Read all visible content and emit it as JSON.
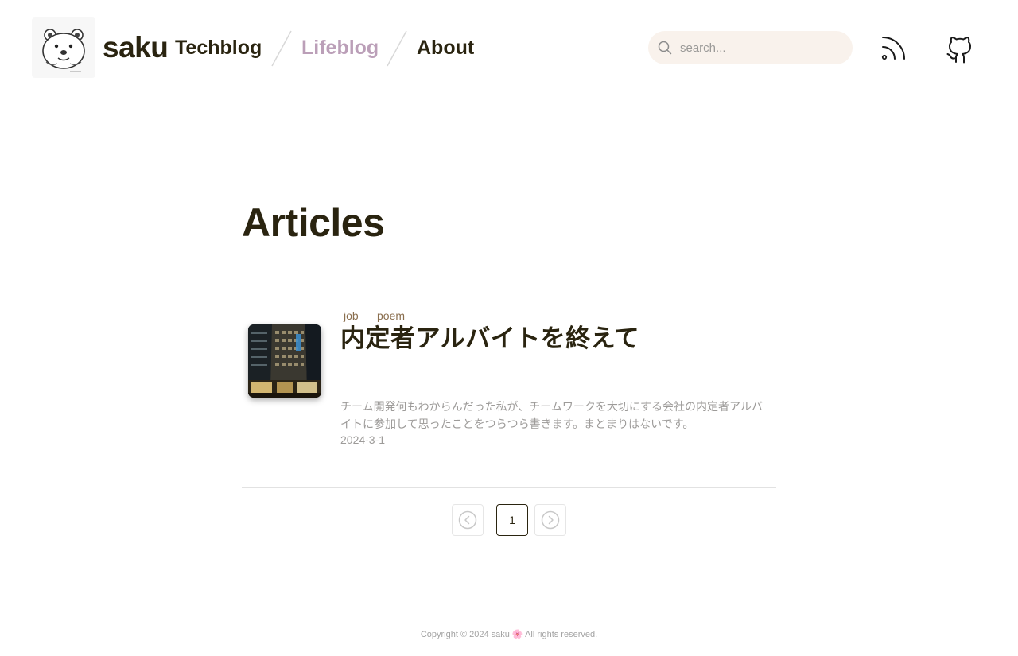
{
  "header": {
    "site_name": "saku",
    "logo_icon": "bear-logo-icon",
    "nav": [
      {
        "label": "Techblog",
        "active": false
      },
      {
        "label": "Lifeblog",
        "active": true
      },
      {
        "label": "About",
        "active": false
      }
    ],
    "search_placeholder": "search...",
    "rss_icon": "rss-icon",
    "github_icon": "github-icon"
  },
  "main": {
    "title": "Articles",
    "articles": [
      {
        "tags": [
          "job",
          "poem"
        ],
        "title": "内定者アルバイトを終えて",
        "description": "チーム開発何もわからんだった私が、チームワークを大切にする会社の内定者アルバイトに参加して思ったことをつらつら書きます。まとまりはないです。",
        "date": "2024-3-1"
      }
    ]
  },
  "pagination": {
    "prev_icon": "chevron-left-circle-icon",
    "current_page": "1",
    "next_icon": "chevron-right-circle-icon"
  },
  "footer": {
    "copyright": "Copyright © 2024 saku 🌸 All rights reserved."
  },
  "colors": {
    "text": "#2a2410",
    "active_nav": "#bb9fb8",
    "tag": "#8a6e4e",
    "muted": "#9d9b99",
    "search_bg": "#f9f2ec"
  }
}
